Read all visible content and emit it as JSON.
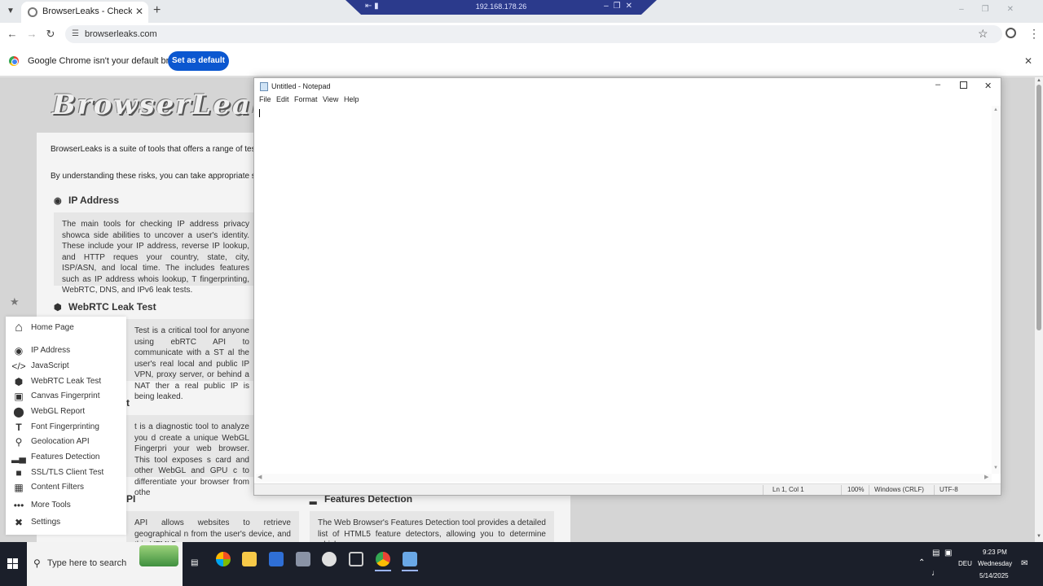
{
  "browser": {
    "tab_title": "BrowserLeaks - Check your brow",
    "url": "browserleaks.com",
    "infobar_text": "Google Chrome isn't your default browser",
    "set_default_label": "Set as default"
  },
  "rdp": {
    "ip": "192.168.178.26"
  },
  "page": {
    "logo_text": "BrowserLeaks.com",
    "intro_1": "BrowserLeaks is a suite of tools that offers a range of tests to ways in which websites may leak your real IP address, colle",
    "intro_2": "By understanding these risks, you can take appropriate step",
    "sections": [
      {
        "title": "IP Address",
        "text": "The main tools for checking IP address privacy showca side abilities to uncover a user's identity. These include your IP address, reverse IP lookup, and HTTP reques your country, state, city, ISP/ASN, and local time. The includes features such as IP address whois lookup, T fingerprinting, WebRTC, DNS, and IPv6 leak tests."
      },
      {
        "title": "WebRTC Leak Test",
        "text": "Test is a critical tool for anyone using ebRTC API to communicate with a ST al the user's real local and public IP VPN, proxy server, or behind a NAT ther a real public IP is being leaked."
      },
      {
        "title": "t",
        "text": "t is a diagnostic tool to analyze you d create a unique WebGL Fingerpri your web browser. This tool exposes s card and other WebGL and GPU c to differentiate your browser from othe"
      },
      {
        "title": "PI",
        "text": "API allows websites to retrieve geographical n from the user's device, and this HTML5"
      },
      {
        "title": "Features Detection",
        "text": "The Web Browser's Features Detection tool provides a detailed list of HTML5 feature detectors, allowing you to determine which"
      }
    ]
  },
  "side_menu": {
    "items": [
      {
        "label": "Home Page",
        "icon": "home-icon"
      },
      {
        "label": "IP Address",
        "icon": "broadcast-icon"
      },
      {
        "label": "JavaScript",
        "icon": "code-icon"
      },
      {
        "label": "WebRTC Leak Test",
        "icon": "webrtc-icon"
      },
      {
        "label": "Canvas Fingerprint",
        "icon": "image-icon"
      },
      {
        "label": "WebGL Report",
        "icon": "cube-icon"
      },
      {
        "label": "Font Fingerprinting",
        "icon": "font-icon"
      },
      {
        "label": "Geolocation API",
        "icon": "location-pin-icon"
      },
      {
        "label": "Features Detection",
        "icon": "bars-icon"
      },
      {
        "label": "SSL/TLS Client Test",
        "icon": "lock-icon"
      },
      {
        "label": "Content Filters",
        "icon": "grid-icon"
      },
      {
        "label": "More Tools",
        "icon": "ellipsis-icon"
      },
      {
        "label": "Settings",
        "icon": "tools-icon"
      }
    ]
  },
  "notepad": {
    "title": "Untitled - Notepad",
    "menu": [
      "File",
      "Edit",
      "Format",
      "View",
      "Help"
    ],
    "status": {
      "position": "Ln 1, Col 1",
      "zoom": "100%",
      "line_ending": "Windows (CRLF)",
      "encoding": "UTF-8"
    }
  },
  "taskbar": {
    "search_placeholder": "Type here to search",
    "time": "9:23 PM",
    "day": "Wednesday",
    "date": "5/14/2025",
    "language": "DEU"
  }
}
